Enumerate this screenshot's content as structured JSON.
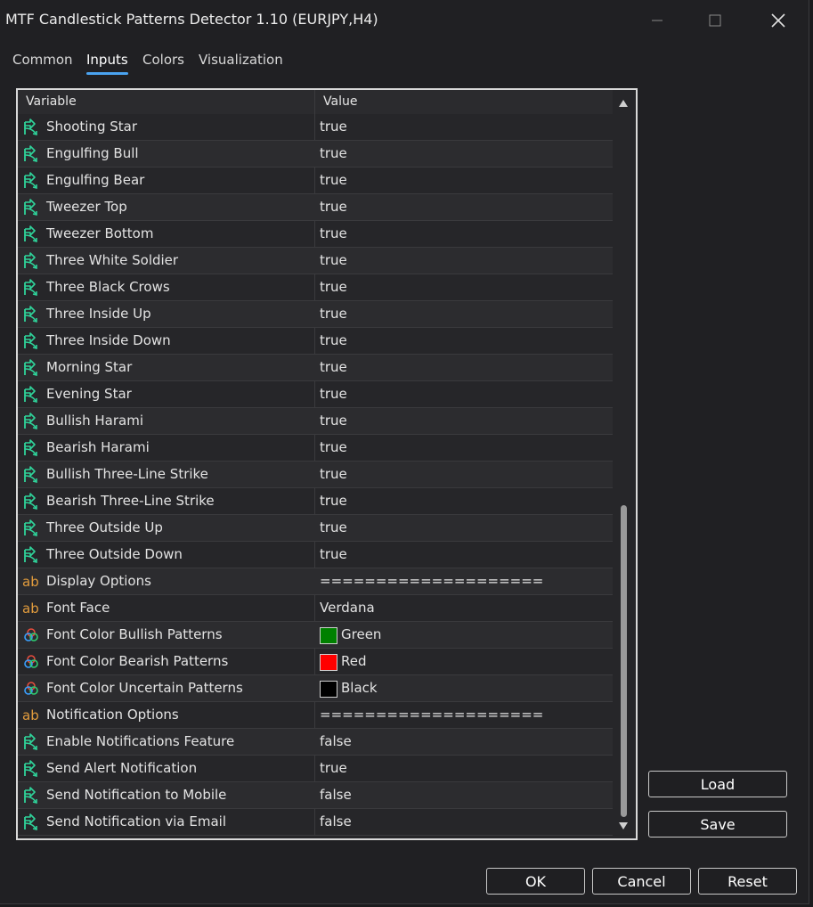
{
  "window": {
    "title": "MTF Candlestick Patterns Detector 1.10 (EURJPY,H4)",
    "minimize_icon": "minimize-icon",
    "maximize_icon": "maximize-icon",
    "close_icon": "close-icon"
  },
  "tabs": [
    {
      "label": "Common"
    },
    {
      "label": "Inputs",
      "active": true
    },
    {
      "label": "Colors"
    },
    {
      "label": "Visualization"
    }
  ],
  "grid": {
    "header": {
      "variable": "Variable",
      "value": "Value"
    },
    "rows": [
      {
        "type": "bool",
        "label": "Shooting Star",
        "value": "true"
      },
      {
        "type": "bool",
        "label": "Engulfing Bull",
        "value": "true"
      },
      {
        "type": "bool",
        "label": "Engulfing Bear",
        "value": "true"
      },
      {
        "type": "bool",
        "label": "Tweezer Top",
        "value": "true"
      },
      {
        "type": "bool",
        "label": "Tweezer Bottom",
        "value": "true"
      },
      {
        "type": "bool",
        "label": "Three White Soldier",
        "value": "true"
      },
      {
        "type": "bool",
        "label": "Three Black Crows",
        "value": "true"
      },
      {
        "type": "bool",
        "label": "Three Inside Up",
        "value": "true"
      },
      {
        "type": "bool",
        "label": "Three Inside Down",
        "value": "true"
      },
      {
        "type": "bool",
        "label": "Morning Star",
        "value": "true"
      },
      {
        "type": "bool",
        "label": "Evening Star",
        "value": "true"
      },
      {
        "type": "bool",
        "label": "Bullish Harami",
        "value": "true"
      },
      {
        "type": "bool",
        "label": "Bearish Harami",
        "value": "true"
      },
      {
        "type": "bool",
        "label": "Bullish Three-Line Strike",
        "value": "true"
      },
      {
        "type": "bool",
        "label": "Bearish Three-Line Strike",
        "value": "true"
      },
      {
        "type": "bool",
        "label": "Three Outside Up",
        "value": "true"
      },
      {
        "type": "bool",
        "label": "Three Outside Down",
        "value": "true"
      },
      {
        "type": "string",
        "label": "Display Options",
        "value": "===================="
      },
      {
        "type": "string",
        "label": "Font Face",
        "value": "Verdana"
      },
      {
        "type": "color",
        "label": "Font Color Bullish Patterns",
        "value": "Green",
        "swatch": "#008000"
      },
      {
        "type": "color",
        "label": "Font Color Bearish Patterns",
        "value": "Red",
        "swatch": "#ff0000"
      },
      {
        "type": "color",
        "label": "Font Color Uncertain Patterns",
        "value": "Black",
        "swatch": "#000000"
      },
      {
        "type": "string",
        "label": "Notification Options",
        "value": "===================="
      },
      {
        "type": "bool",
        "label": "Enable Notifications Feature",
        "value": "false"
      },
      {
        "type": "bool",
        "label": "Send Alert Notification",
        "value": "true"
      },
      {
        "type": "bool",
        "label": "Send Notification to Mobile",
        "value": "false"
      },
      {
        "type": "bool",
        "label": "Send Notification via Email",
        "value": "false"
      }
    ]
  },
  "icons": {
    "bool": "bool-arrow-icon",
    "string": "ab-string-icon",
    "color": "color-palette-icon",
    "string_glyph": "ab"
  },
  "colors": {
    "bool_icon": "#2fd39a",
    "string_icon": "#e09b3d",
    "tab_underline": "#4aa3f0"
  },
  "buttons": {
    "load": "Load",
    "save": "Save",
    "ok": "OK",
    "cancel": "Cancel",
    "reset": "Reset"
  }
}
